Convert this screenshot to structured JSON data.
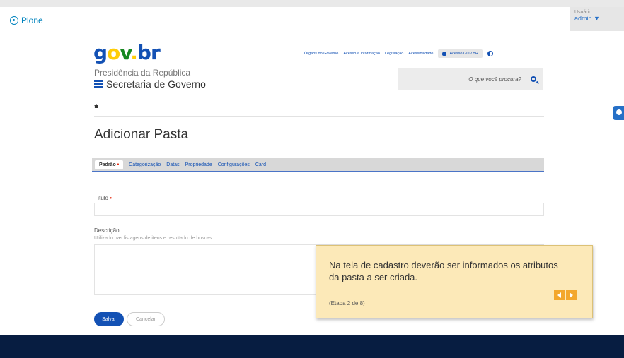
{
  "plone": {
    "label": "Plone"
  },
  "user": {
    "caption": "Usuário",
    "name": "admin ▼"
  },
  "header": {
    "logo": {
      "g": "g",
      "o": "o",
      "v": "v",
      "dot": ".",
      "br": "br"
    },
    "subtitle": "Presidência da República",
    "secretaria": "Secretaria de Governo",
    "links": [
      "Órgãos do Governo",
      "Acesso à Informação",
      "Legislação",
      "Acessibilidade"
    ],
    "login_label": "Acesso GOV.BR",
    "search_placeholder": "O que você procura?"
  },
  "page": {
    "title": "Adicionar Pasta"
  },
  "tabs": [
    {
      "label": "Padrão"
    },
    {
      "label": "Categorização"
    },
    {
      "label": "Datas"
    },
    {
      "label": "Propriedade"
    },
    {
      "label": "Configurações"
    },
    {
      "label": "Card"
    }
  ],
  "required_mark": "•",
  "form": {
    "titulo_label": "Título",
    "descricao_label": "Descrição",
    "descricao_help": "Utilizado nas listagens de itens e resultado de buscas",
    "save": "Salvar",
    "cancel": "Cancelar"
  },
  "tooltip": {
    "message": "Na tela de cadastro deverão ser informados os atributos da pasta a ser criada.",
    "step": "(Etapa 2 de 8)"
  }
}
